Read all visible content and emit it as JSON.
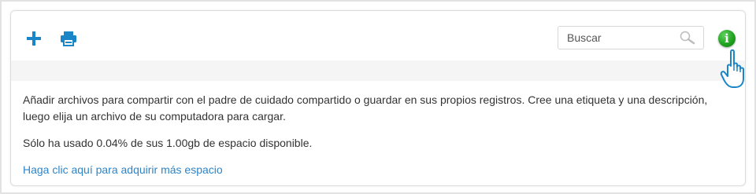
{
  "toolbar": {
    "add_icon": "plus-icon",
    "print_icon": "printer-icon",
    "search_placeholder": "Buscar",
    "search_value": "",
    "search_icon": "magnifier-icon",
    "info_icon": "info-icon",
    "info_glyph": "i"
  },
  "content": {
    "description": "Añadir archivos para compartir con el padre de cuidado compartido o guardar en sus propios registros. Cree una etiqueta y una descripción, luego elija un archivo de su computadora para cargar.",
    "usage_text": "Sólo ha usado 0.04% de sus 1.00gb de espacio disponible.",
    "more_space_link": "Haga clic aquí para adquirir más espacio"
  },
  "colors": {
    "accent_blue": "#1a86c8",
    "link_blue": "#2f84c6",
    "info_green": "#21a321",
    "strip_gray": "#f5f5f5"
  }
}
